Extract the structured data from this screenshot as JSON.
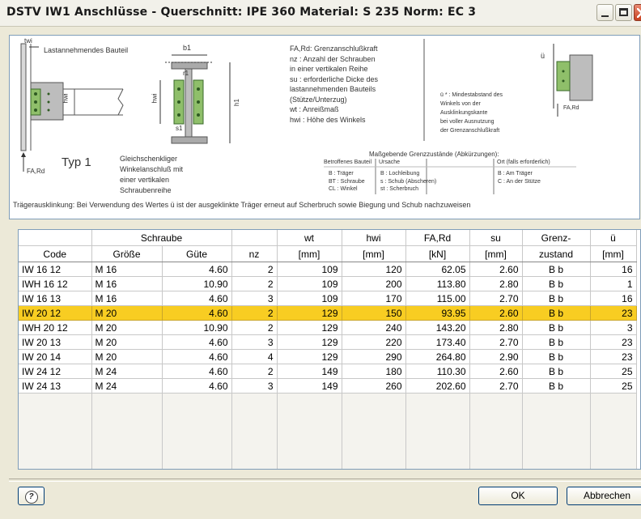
{
  "window": {
    "title": "DSTV IW1 Anschlüsse - Querschnitt: IPE 360    Material: S 235    Norm: EC 3"
  },
  "info": {
    "diagram_labels": {
      "twi": "twi",
      "bauteil": "Lastannehmendes Bauteil",
      "b1": "b1",
      "r1": "r1",
      "hwi1": "hwi",
      "hwi2": "hwi",
      "h1": "h1",
      "s1": "s1",
      "fard": "FA,Rd",
      "w1": "w1",
      "typ": "Typ 1",
      "typ_desc": [
        "Gleichschenkliger",
        "Winkelanschluß mit",
        "einer vertikalen",
        "Schraubenreihe"
      ]
    },
    "legend_left": [
      "FA,Rd: Grenzanschlußkraft",
      "nz    : Anzahl der Schrauben",
      "          in einer vertikalen Reihe",
      "su     : erforderliche Dicke des",
      "          lastannehmenden Bauteils",
      "          (Stütze/Unterzug)",
      "wt     : Anreißmaß",
      "hwi   : Höhe des Winkels"
    ],
    "legend_right": [
      "ü *   : Mindestabstand des",
      "         Winkels von der",
      "         Ausklinkungskante",
      "         bei voller Ausnutzung",
      "         der Grenzanschlußkraft"
    ],
    "right_diagram": {
      "u_label": "ü",
      "fard": "FA,Rd"
    },
    "grenz_title": "Maßgebende Grenzzustände (Abkürzungen):",
    "grenz_headers": [
      "Betroffenes Bauteil",
      "Ursache",
      "Ort (falls erforderlich)"
    ],
    "grenz_col1": [
      "B    : Träger",
      "BT  : Schraube",
      "CL  : Winkel"
    ],
    "grenz_col2": [
      "B    : Lochleibung",
      "s     : Schub (Abscheren)",
      "st    : Scherbruch"
    ],
    "grenz_col3": [
      "B  : Am Träger",
      "C  : An der Stütze"
    ],
    "footnote": "Trägerausklinkung: Bei Verwendung  des Wertes ü ist der ausgeklinkte Träger erneut auf Scherbruch sowie Biegung und Schub nachzuweisen"
  },
  "table": {
    "group_header": "Schraube",
    "headers_top": [
      "",
      "",
      "",
      "",
      "wt",
      "hwi",
      "FA,Rd",
      "su",
      "Grenz-",
      "ü"
    ],
    "headers": [
      "Code",
      "Größe",
      "Güte",
      "nz",
      "[mm]",
      "[mm]",
      "[kN]",
      "[mm]",
      "zustand",
      "[mm]"
    ],
    "rows": [
      [
        "IW 16 12",
        "M 16",
        "4.60",
        "2",
        "109",
        "120",
        "62.05",
        "2.60",
        "B b",
        "16"
      ],
      [
        "IWH 16 12",
        "M 16",
        "10.90",
        "2",
        "109",
        "200",
        "113.80",
        "2.80",
        "B b",
        "1"
      ],
      [
        "IW 16 13",
        "M 16",
        "4.60",
        "3",
        "109",
        "170",
        "115.00",
        "2.70",
        "B b",
        "16"
      ],
      [
        "IW 20 12",
        "M 20",
        "4.60",
        "2",
        "129",
        "150",
        "93.95",
        "2.60",
        "B b",
        "23"
      ],
      [
        "IWH 20 12",
        "M 20",
        "10.90",
        "2",
        "129",
        "240",
        "143.20",
        "2.80",
        "B b",
        "3"
      ],
      [
        "IW 20 13",
        "M 20",
        "4.60",
        "3",
        "129",
        "220",
        "173.40",
        "2.70",
        "B b",
        "23"
      ],
      [
        "IW 20 14",
        "M 20",
        "4.60",
        "4",
        "129",
        "290",
        "264.80",
        "2.90",
        "B b",
        "23"
      ],
      [
        "IW 24 12",
        "M 24",
        "4.60",
        "2",
        "149",
        "180",
        "110.30",
        "2.60",
        "B b",
        "25"
      ],
      [
        "IW 24 13",
        "M 24",
        "4.60",
        "3",
        "149",
        "260",
        "202.60",
        "2.70",
        "B b",
        "25"
      ]
    ],
    "selected_row": 3
  },
  "buttons": {
    "help_icon": "help-icon",
    "help_glyph": "?",
    "ok": "OK",
    "cancel": "Abbrechen"
  },
  "colors": {
    "selected_row": "#f8cd22",
    "window_bg": "#ece9d8",
    "close_button": "#c8401f"
  }
}
